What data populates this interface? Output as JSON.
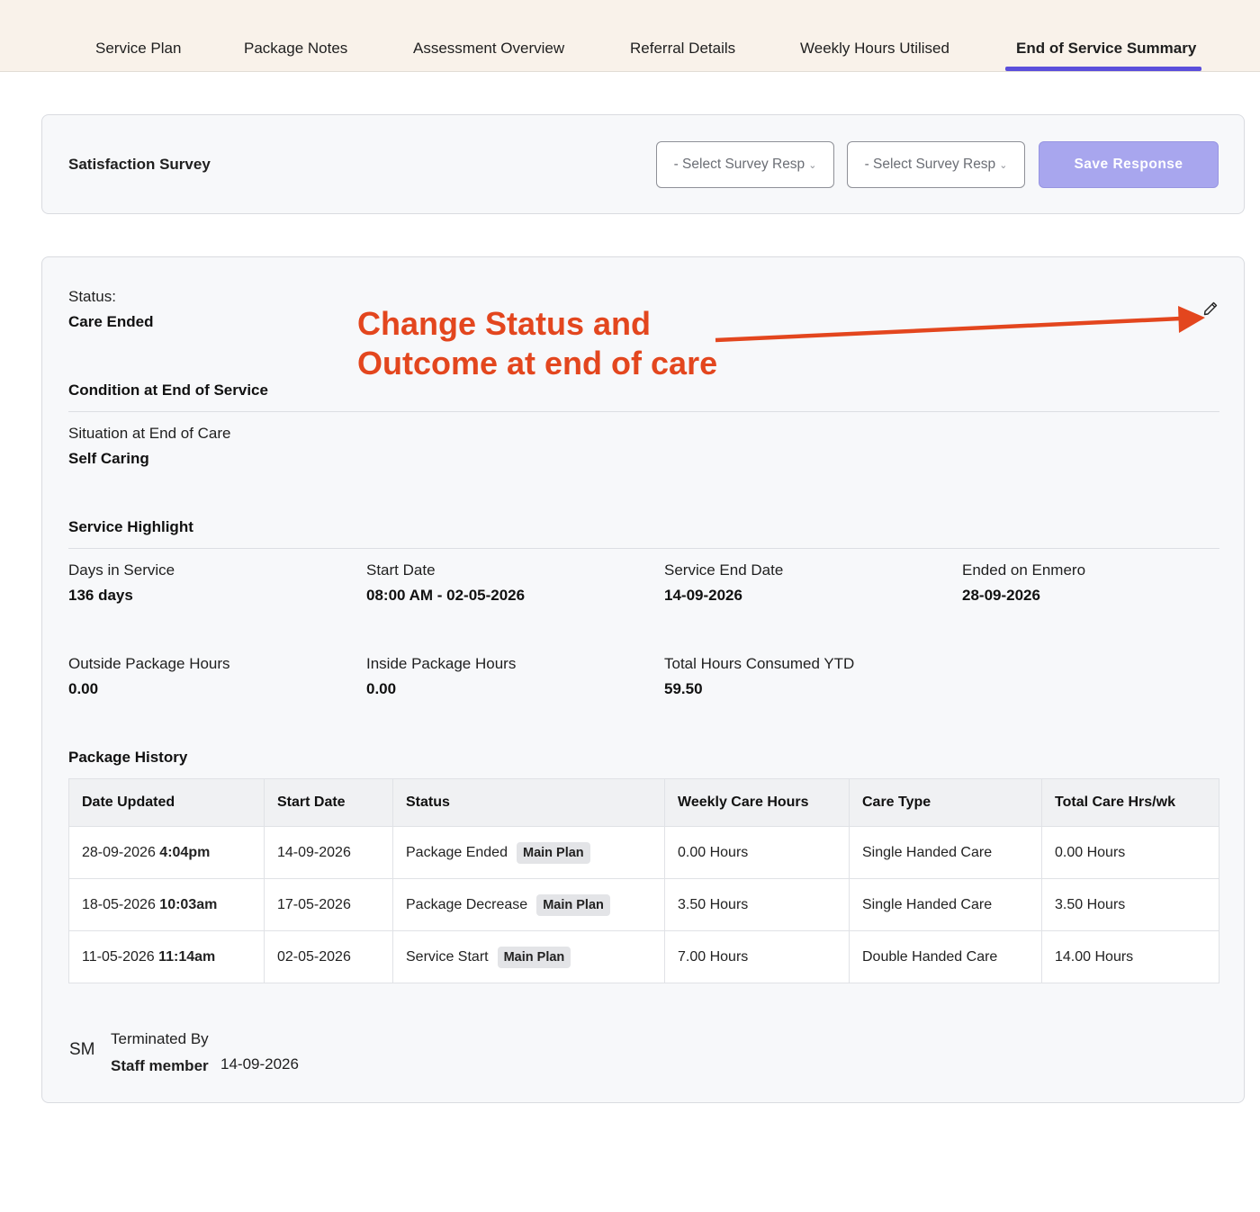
{
  "tabs": [
    {
      "label": "Service Plan"
    },
    {
      "label": "Package Notes"
    },
    {
      "label": "Assessment Overview"
    },
    {
      "label": "Referral Details"
    },
    {
      "label": "Weekly Hours Utilised"
    },
    {
      "label": "End of Service Summary",
      "active": true
    }
  ],
  "survey": {
    "title": "Satisfaction Survey",
    "select1": "- Select Survey Resp",
    "select2": "- Select Survey Resp",
    "save_label": "Save Response"
  },
  "status": {
    "label": "Status:",
    "value": "Care Ended"
  },
  "annotation": {
    "line1": "Change Status and",
    "line2": "Outcome at end of care"
  },
  "condition": {
    "title": "Condition at End of Service",
    "situation_label": "Situation at End of Care",
    "situation_value": "Self Caring"
  },
  "highlight": {
    "title": "Service Highlight",
    "days_label": "Days in Service",
    "days_value": "136 days",
    "start_label": "Start Date",
    "start_value": "08:00 AM - 02-05-2026",
    "end_label": "Service End Date",
    "end_value": "14-09-2026",
    "enmero_label": "Ended on Enmero",
    "enmero_value": "28-09-2026",
    "outside_label": "Outside Package Hours",
    "outside_value": "0.00",
    "inside_label": "Inside Package Hours",
    "inside_value": "0.00",
    "ytd_label": "Total Hours Consumed YTD",
    "ytd_value": "59.50"
  },
  "history": {
    "title": "Package History",
    "columns": [
      "Date Updated",
      "Start Date",
      "Status",
      "Weekly Care Hours",
      "Care Type",
      "Total Care Hrs/wk"
    ],
    "rows": [
      {
        "date": "28-09-2026",
        "time": "4:04pm",
        "start": "14-09-2026",
        "status": "Package Ended",
        "badge": "Main Plan",
        "weekly": "0.00 Hours",
        "care_type": "Single Handed Care",
        "total": "0.00 Hours"
      },
      {
        "date": "18-05-2026",
        "time": "10:03am",
        "start": "17-05-2026",
        "status": "Package Decrease",
        "badge": "Main Plan",
        "weekly": "3.50 Hours",
        "care_type": "Single Handed Care",
        "total": "3.50 Hours"
      },
      {
        "date": "11-05-2026",
        "time": "11:14am",
        "start": "02-05-2026",
        "status": "Service Start",
        "badge": "Main Plan",
        "weekly": "7.00 Hours",
        "care_type": "Double Handed Care",
        "total": "14.00 Hours"
      }
    ]
  },
  "termination": {
    "initials": "SM",
    "label": "Terminated By",
    "name": "Staff member",
    "date": "14-09-2026"
  },
  "colors": {
    "accent": "#5b4fdb",
    "annotation": "#e3461e",
    "save_button": "#a8a6ee",
    "tabbar_bg": "#f9f2ea"
  },
  "icons": {
    "edit": "pencil-icon",
    "select_chevron": "chevron-down-icon",
    "annotation_arrow": "arrow-right-icon"
  }
}
